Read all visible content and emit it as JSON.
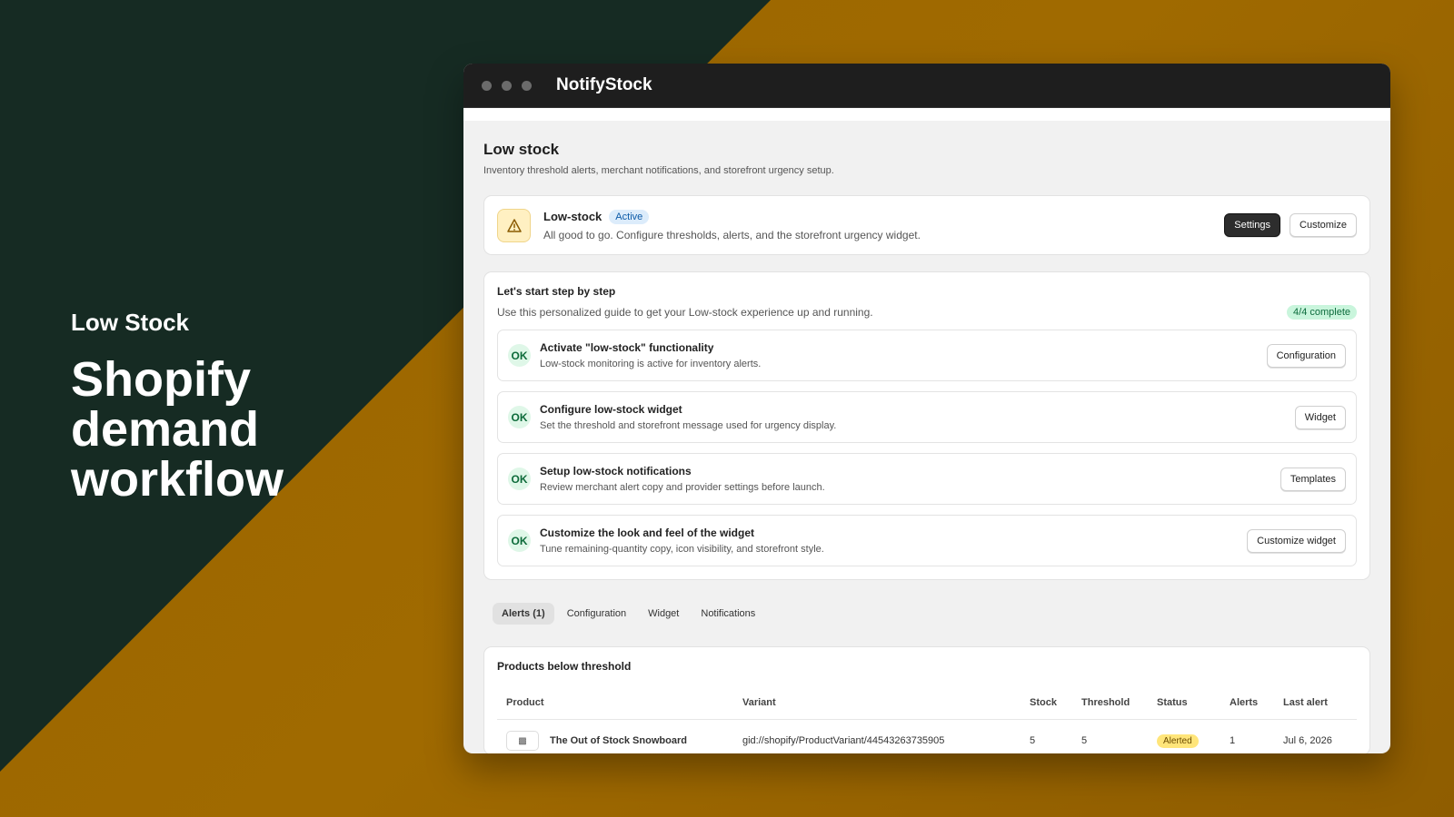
{
  "hero": {
    "eyebrow": "Low Stock",
    "title": "Shopify demand workflow"
  },
  "window": {
    "app_name": "NotifyStock"
  },
  "page": {
    "title": "Low stock",
    "subtitle": "Inventory threshold alerts, merchant notifications, and storefront urgency setup."
  },
  "status_card": {
    "icon": "warning-icon",
    "name": "Low-stock",
    "badge": "Active",
    "description": "All good to go. Configure thresholds, alerts, and the storefront urgency widget.",
    "settings_label": "Settings",
    "customize_label": "Customize"
  },
  "guide": {
    "title": "Let's start step by step",
    "subtitle": "Use this personalized guide to get your Low-stock experience up and running.",
    "progress": "4/4 complete",
    "steps": [
      {
        "badge": "OK",
        "title": "Activate \"low-stock\" functionality",
        "description": "Low-stock monitoring is active for inventory alerts.",
        "button": "Configuration"
      },
      {
        "badge": "OK",
        "title": "Configure low-stock widget",
        "description": "Set the threshold and storefront message used for urgency display.",
        "button": "Widget"
      },
      {
        "badge": "OK",
        "title": "Setup low-stock notifications",
        "description": "Review merchant alert copy and provider settings before launch.",
        "button": "Templates"
      },
      {
        "badge": "OK",
        "title": "Customize the look and feel of the widget",
        "description": "Tune remaining-quantity copy, icon visibility, and storefront style.",
        "button": "Customize widget"
      }
    ]
  },
  "tabs": [
    "Alerts (1)",
    "Configuration",
    "Widget",
    "Notifications"
  ],
  "table": {
    "title": "Products below threshold",
    "columns": [
      "Product",
      "Variant",
      "Stock",
      "Threshold",
      "Status",
      "Alerts",
      "Last alert"
    ],
    "rows": [
      {
        "product": "The Out of Stock Snowboard",
        "variant": "gid://shopify/ProductVariant/44543263735905",
        "stock": "5",
        "threshold": "5",
        "status": "Alerted",
        "alerts": "1",
        "last_alert": "Jul 6, 2026"
      }
    ]
  },
  "colors": {
    "dark_bg": "#162b23",
    "gold_bg": "#9a6500",
    "active_badge": "#dcecfb",
    "complete_badge": "#c9f5dc",
    "alerted_badge": "#ffe57a"
  }
}
